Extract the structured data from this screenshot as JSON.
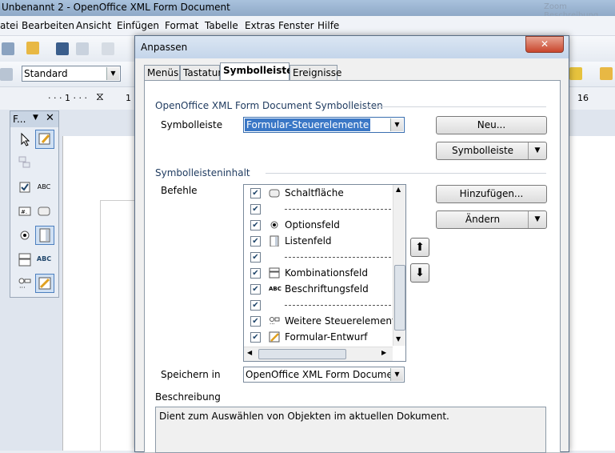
{
  "window": {
    "title": "Unbenannt 2 - OpenOffice XML Form Document",
    "right_blur": "Zoom  Beschreibung"
  },
  "menu": [
    "atei",
    "Bearbeiten",
    "Ansicht",
    "Einfügen",
    "Format",
    "Tabelle",
    "Extras",
    "Fenster",
    "Hilfe"
  ],
  "toolbar": {
    "style_value": "Standard"
  },
  "ruler": {
    "left_marks": "· · · 1 · · ·",
    "tick_16": "16",
    "tick_1": "1"
  },
  "form_toolbar": {
    "title": "F..."
  },
  "dialog": {
    "title": "Anpassen",
    "close": "✕",
    "tabs": [
      "Menüs",
      "Tastatur",
      "Symbolleisten",
      "Ereignisse"
    ],
    "section1": "OpenOffice XML Form Document Symbolleisten",
    "toolbar_label": "Symbolleiste",
    "toolbar_value": "Formular-Steuerelemente",
    "new_button": "Neu...",
    "toolbar_button": "Symbolleiste",
    "section2": "Symbolleisteninhalt",
    "commands_label": "Befehle",
    "commands": [
      {
        "type": "item",
        "label": "Schaltfläche",
        "checked": true,
        "icon": "button-icon"
      },
      {
        "type": "separator",
        "checked": true
      },
      {
        "type": "item",
        "label": "Optionsfeld",
        "checked": true,
        "icon": "radio-icon"
      },
      {
        "type": "item",
        "label": "Listenfeld",
        "checked": true,
        "icon": "listbox-icon"
      },
      {
        "type": "separator",
        "checked": true
      },
      {
        "type": "item",
        "label": "Kombinationsfeld",
        "checked": true,
        "icon": "combobox-icon"
      },
      {
        "type": "item",
        "label": "Beschriftungsfeld",
        "checked": true,
        "icon": "label-field-icon",
        "icon_text": "ABC"
      },
      {
        "type": "separator",
        "checked": true
      },
      {
        "type": "item",
        "label": "Weitere Steuerelemente",
        "checked": true,
        "icon": "more-controls-icon"
      },
      {
        "type": "item",
        "label": "Formular-Entwurf",
        "checked": true,
        "icon": "form-design-icon"
      }
    ],
    "add_button": "Hinzufügen...",
    "modify_button": "Ändern",
    "save_in_label": "Speichern in",
    "save_in_value": "OpenOffice XML Form Document",
    "description_label": "Beschreibung",
    "description_text": "Dient zum Auswählen von Objekten im aktuellen Dokument."
  }
}
